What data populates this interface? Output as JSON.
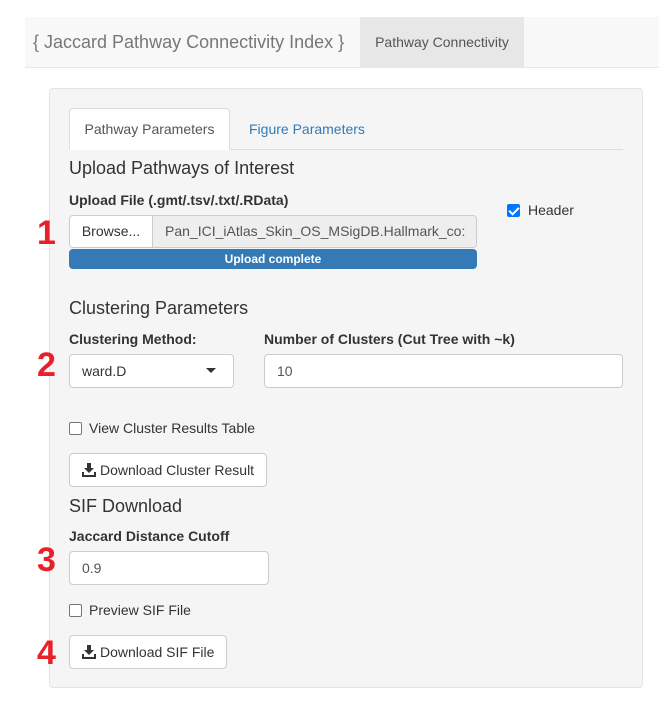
{
  "navbar": {
    "brand": "{ Jaccard Pathway Connectivity Index }",
    "tab": "Pathway Connectivity"
  },
  "tabs": [
    {
      "label": "Pathway Parameters",
      "active": true
    },
    {
      "label": "Figure Parameters",
      "active": false
    }
  ],
  "upload": {
    "section_title": "Upload Pathways of Interest",
    "file_label": "Upload File (.gmt/.tsv/.txt/.RData)",
    "browse_label": "Browse...",
    "file_name": "Pan_ICI_iAtlas_Skin_OS_MSigDB.Hallmark_co:",
    "progress_text": "Upload complete",
    "progress_fraction": 1.0,
    "header_checkbox_label": "Header",
    "header_checked": true
  },
  "clustering": {
    "section_title": "Clustering Parameters",
    "method_label": "Clustering Method:",
    "method_value": "ward.D",
    "clusters_label": "Number of Clusters (Cut Tree with ~k)",
    "clusters_value": "10",
    "view_table_label": "View Cluster Results Table",
    "view_table_checked": false,
    "download_label": "Download Cluster Result"
  },
  "sif": {
    "section_title": "SIF Download",
    "cutoff_label": "Jaccard Distance Cutoff",
    "cutoff_value": "0.9",
    "preview_label": "Preview SIF File",
    "preview_checked": false,
    "download_label": "Download SIF File"
  },
  "annotations": [
    "1",
    "2",
    "3",
    "4"
  ],
  "colors": {
    "accent": "#337ab7",
    "annotation_red": "#e8202a",
    "checkbox_blue": "#0075ff"
  },
  "icons": {
    "download": "download-icon",
    "dropdown": "caret-down-icon"
  }
}
